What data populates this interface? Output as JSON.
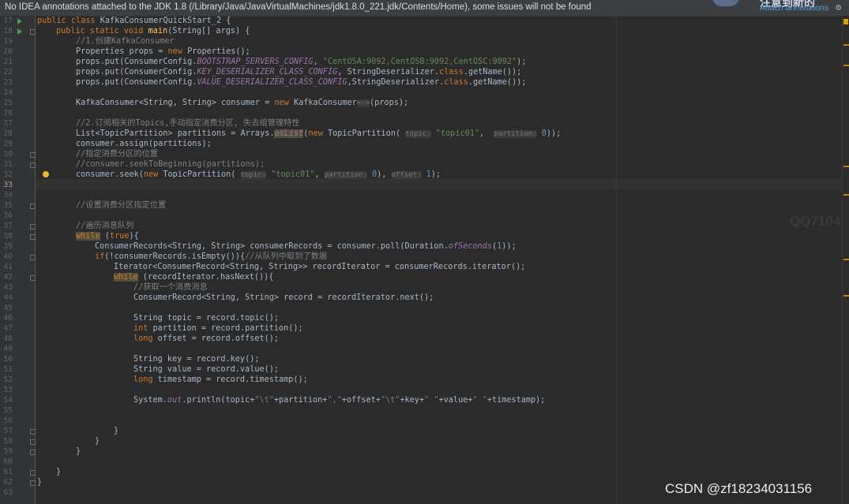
{
  "banner": {
    "message": "No IDEA annotations attached to the JDK 1.8 (/Library/Java/JavaVirtualMachines/jdk1.8.0_221.jdk/Contents/Home), some issues will not be found",
    "attach_label": "Attach annotations",
    "cut_heading": "注意到新的"
  },
  "code": {
    "line_numbers": [
      "17",
      "18",
      "19",
      "20",
      "21",
      "22",
      "23",
      "24",
      "25",
      "26",
      "27",
      "28",
      "29",
      "30",
      "31",
      "32",
      "33",
      "34",
      "35",
      "36",
      "37",
      "38",
      "39",
      "40",
      "41",
      "42",
      "43",
      "44",
      "45",
      "46",
      "47",
      "48",
      "49",
      "50",
      "51",
      "52",
      "53",
      "54",
      "55",
      "56",
      "57",
      "58",
      "59",
      "60",
      "61",
      "62",
      "63"
    ],
    "current_line": "33",
    "comment_create": "//1.创建KafkaConsumer",
    "comment_subscribe": "//2.订阅相关的Topics,手动指定消费分区, 失去组管理特性",
    "comment_position": "//指定消费分区的位置",
    "comment_seek_begin": "//consumer.seekToBeginning(partitions);",
    "comment_set_position": "//设置消费分区指定位置",
    "comment_iterate": "//遍历消息队列",
    "comment_fetched": "//从队列中取到了数据",
    "comment_get_one": "//获取一个消费消息",
    "servers": "\"CentOSA:9092,CentOSB:9092,CentOSC:9092\"",
    "topic": "\"topic01\"",
    "hint_topic": "topic:",
    "hint_partition": "partition:",
    "hint_offset": "offset:",
    "partition_value": "0",
    "offset_value": "1",
    "poll_seconds": "1"
  },
  "watermarks": {
    "qq": "QQ7104",
    "csdn": "CSDN @zf18234031156"
  },
  "colors": {
    "background": "#2b2b2b",
    "keyword": "#cc7832",
    "string": "#6a8759",
    "number": "#6897bb",
    "comment": "#808080",
    "field": "#9876aa",
    "method": "#ffc66d",
    "text": "#a9b7c6"
  }
}
